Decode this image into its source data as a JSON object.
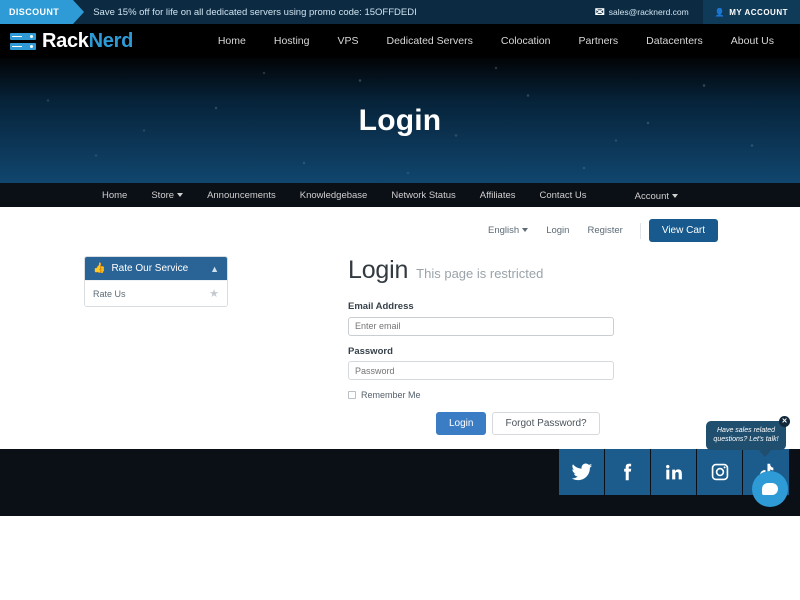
{
  "promo": {
    "tag": "DISCOUNT",
    "text": "Save 15% off for life on all dedicated servers using promo code: 15OFFDEDI",
    "email": "sales@racknerd.com",
    "email_icon": "envelope-icon",
    "account_button": "MY ACCOUNT",
    "tag_color": "#2e9bd6",
    "bar_color": "#0c2b42"
  },
  "brand": {
    "name_first": "Rack",
    "name_second": "Nerd",
    "accent_color": "#2e9bd6"
  },
  "main_nav": {
    "items": [
      {
        "label": "Home"
      },
      {
        "label": "Hosting"
      },
      {
        "label": "VPS"
      },
      {
        "label": "Dedicated Servers"
      },
      {
        "label": "Colocation"
      },
      {
        "label": "Partners"
      },
      {
        "label": "Datacenters"
      },
      {
        "label": "About Us"
      }
    ]
  },
  "hero": {
    "title": "Login"
  },
  "secondary_nav": {
    "items": [
      {
        "label": "Home",
        "has_caret": false
      },
      {
        "label": "Store",
        "has_caret": true
      },
      {
        "label": "Announcements",
        "has_caret": false
      },
      {
        "label": "Knowledgebase",
        "has_caret": false
      },
      {
        "label": "Network Status",
        "has_caret": false
      },
      {
        "label": "Affiliates",
        "has_caret": false
      },
      {
        "label": "Contact Us",
        "has_caret": false
      }
    ],
    "account_label": "Account"
  },
  "utility_bar": {
    "language": "English",
    "login": "Login",
    "register": "Register",
    "view_cart": "View Cart",
    "view_cart_color": "#185a8d"
  },
  "sidebar": {
    "panel_title": "Rate Our Service",
    "panel_icon": "thumbs-up-icon",
    "collapse_icon": "chevron-up-icon",
    "items": [
      {
        "label": "Rate Us",
        "icon": "star-icon"
      }
    ],
    "header_color": "#2a6496"
  },
  "login_page": {
    "title": "Login",
    "subtitle": "This page is restricted",
    "email_label": "Email Address",
    "email_placeholder": "Enter email",
    "email_value": "",
    "password_label": "Password",
    "password_placeholder": "Password",
    "password_value": "",
    "remember_label": "Remember Me",
    "remember_checked": false,
    "submit_label": "Login",
    "forgot_label": "Forgot Password?",
    "submit_color": "#3b7dc4"
  },
  "footer": {
    "social": [
      {
        "name": "twitter-icon"
      },
      {
        "name": "facebook-icon"
      },
      {
        "name": "linkedin-icon"
      },
      {
        "name": "instagram-icon"
      },
      {
        "name": "tiktok-icon"
      }
    ],
    "social_color": "#1b5c8c",
    "background": "#0b1017"
  },
  "chat_widget": {
    "tooltip_line1": "Have sales related",
    "tooltip_line2": "questions? Let's talk!",
    "close_label": "✕",
    "bubble_icon": "chat-bubble-icon",
    "bubble_color": "#2e9bd6"
  }
}
